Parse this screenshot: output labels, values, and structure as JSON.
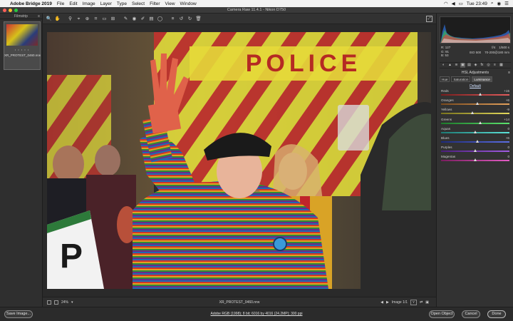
{
  "menubar": {
    "app": "Adobe Bridge 2019",
    "items": [
      "File",
      "Edit",
      "Image",
      "Layer",
      "Type",
      "Select",
      "Filter",
      "View",
      "Window"
    ],
    "clock": "Tue 23:49"
  },
  "window": {
    "title": "Camera Raw 11.4.1  -  Nikon D750"
  },
  "filmstrip": {
    "title": "Filmstrip",
    "stars": "• • • • •",
    "file": "XR_PROTEST_0460.nrw"
  },
  "toolbar": {
    "tools": [
      "zoom-icon",
      "hand-icon",
      "white-balance-icon",
      "color-sampler-icon",
      "target-adjust-icon",
      "crop-icon",
      "straighten-icon",
      "transform-icon",
      "spot-removal-icon",
      "red-eye-icon",
      "adjustment-brush-icon",
      "graduated-filter-icon",
      "radial-filter-icon",
      "preferences-icon",
      "rotate-left-icon",
      "rotate-right-icon",
      "trash-icon"
    ],
    "glyphs": [
      "🔍",
      "✋",
      "⚲",
      "⌖",
      "⊕",
      "⌗",
      "▭",
      "⊞",
      "✎",
      "◉",
      "✐",
      "▤",
      "◯",
      "≡",
      "↺",
      "↻",
      "🗑"
    ]
  },
  "readout": {
    "r_label": "R:",
    "r": "127",
    "g_label": "G:",
    "g": "91",
    "b_label": "B:",
    "b": "53",
    "aperture": "f/4",
    "shutter": "1/500 s",
    "iso": "ISO 500",
    "lens": "70-200@180 mm"
  },
  "panel": {
    "tool_glyphs": [
      "◐",
      "▲",
      "≋",
      "▣",
      "▤",
      "◈",
      "fx",
      "◎",
      "≡",
      "▦"
    ],
    "section_title": "HSL Adjustments",
    "tabs": [
      "Hue",
      "Saturation",
      "Luminance"
    ],
    "active_tab": 2,
    "default_label": "Default"
  },
  "hsl": [
    {
      "label": "Reds",
      "value": "+15",
      "num": 15,
      "colors": [
        "#7a1d1d",
        "#e35c5c"
      ]
    },
    {
      "label": "Oranges",
      "value": "+6",
      "num": 6,
      "colors": [
        "#7a4a1d",
        "#e3a15c"
      ]
    },
    {
      "label": "Yellows",
      "value": "-9",
      "num": -9,
      "colors": [
        "#7a741d",
        "#e3d95c"
      ]
    },
    {
      "label": "Greens",
      "value": "+14",
      "num": 14,
      "colors": [
        "#1d7a2a",
        "#5ce36e"
      ]
    },
    {
      "label": "Aquas",
      "value": "0",
      "num": 0,
      "colors": [
        "#1d7a74",
        "#5ce3d9"
      ]
    },
    {
      "label": "Blues",
      "value": "+6",
      "num": 6,
      "colors": [
        "#1d2a7a",
        "#5c6ee3"
      ]
    },
    {
      "label": "Purples",
      "value": "0",
      "num": 0,
      "colors": [
        "#4a1d7a",
        "#a15ce3"
      ]
    },
    {
      "label": "Magentas",
      "value": "0",
      "num": 0,
      "colors": [
        "#7a1d5e",
        "#e35cc4"
      ]
    }
  ],
  "status": {
    "zoom": "24%",
    "file": "XR_PROTEST_0460.nrw",
    "image_count": "Image 1/1"
  },
  "bottom": {
    "save": "Save Image...",
    "workflow": "Adobe RGB (1998); 8 bit; 6016 by 4016 (24.2MP); 300 ppi",
    "open": "Open Object",
    "cancel": "Cancel",
    "done": "Done"
  },
  "photo": {
    "sign_text": "POLICE"
  }
}
